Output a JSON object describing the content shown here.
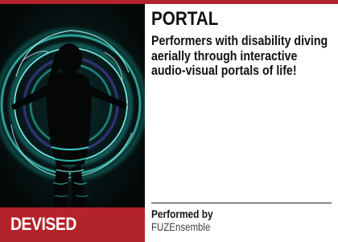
{
  "show": {
    "title": "PORTAL",
    "description": "Performers with disability diving aerially through interactive audio-visual portals of life!",
    "category": "DEVISED",
    "performed_by_label": "Performed by",
    "performer": "FUZEnsemble"
  },
  "image": {
    "subject": "performer-in-glowing-portal"
  },
  "colors": {
    "accent": "#b3232b",
    "portal_glow": "#2ee6d6",
    "text": "#111111"
  }
}
